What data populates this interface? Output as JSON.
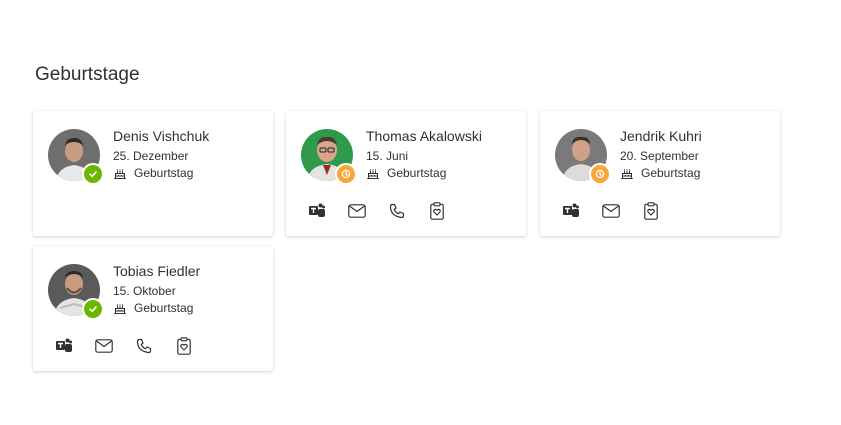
{
  "section": {
    "title": "Geburtstage"
  },
  "presence_colors": {
    "available": "#6bb700",
    "away": "#f8a738"
  },
  "cards": [
    {
      "name": "Denis Vishchuk",
      "date": "25. Dezember",
      "event_label": "Geburtstag",
      "presence": "available",
      "avatar_bg": "#6e6e6e",
      "actions": []
    },
    {
      "name": "Thomas Akalowski",
      "date": "15. Juni",
      "event_label": "Geburtstag",
      "presence": "away",
      "avatar_bg": "#2e9a4a",
      "actions": [
        "teams-icon",
        "mail-icon",
        "phone-icon",
        "clipboard-heart-icon"
      ]
    },
    {
      "name": "Jendrik Kuhri",
      "date": "20. September",
      "event_label": "Geburtstag",
      "presence": "away",
      "avatar_bg": "#7a7a7a",
      "actions": [
        "teams-icon",
        "mail-icon",
        "clipboard-heart-icon"
      ]
    },
    {
      "name": "Tobias Fiedler",
      "date": "15. Oktober",
      "event_label": "Geburtstag",
      "presence": "available",
      "avatar_bg": "#5a5a5a",
      "actions": [
        "teams-icon",
        "mail-icon",
        "phone-icon",
        "clipboard-heart-icon"
      ]
    }
  ]
}
